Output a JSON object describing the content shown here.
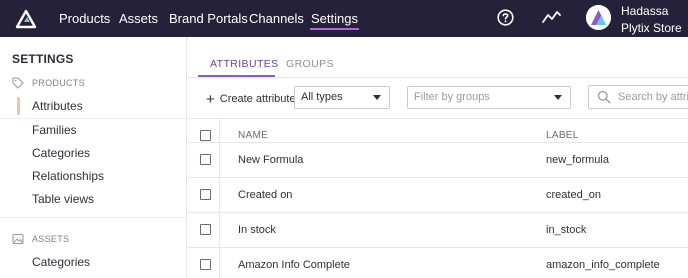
{
  "nav": {
    "items": [
      {
        "label": "Products"
      },
      {
        "label": "Assets"
      },
      {
        "label": "Brand Portals"
      },
      {
        "label": "Channels"
      },
      {
        "label": "Settings",
        "active": true
      }
    ],
    "help_icon": "question-circle-icon",
    "activity_icon": "activity-chart-icon",
    "accent_color": "#a86ad8"
  },
  "user": {
    "first_line": "Hadassa",
    "second_line": "Plytix Store"
  },
  "sidebar": {
    "title": "SETTINGS",
    "products_section": {
      "label": "PRODUCTS",
      "icon": "tag-icon",
      "items": [
        {
          "label": "Attributes",
          "active": true
        },
        {
          "label": "Families"
        },
        {
          "label": "Categories"
        },
        {
          "label": "Relationships"
        },
        {
          "label": "Table views"
        }
      ]
    },
    "assets_section": {
      "label": "ASSETS",
      "icon": "image-icon",
      "items": [
        {
          "label": "Categories"
        }
      ]
    }
  },
  "tabs": [
    {
      "label": "ATTRIBUTES",
      "active": true
    },
    {
      "label": "GROUPS"
    }
  ],
  "toolbar": {
    "create_label": "Create attribute",
    "type_select_value": "All types",
    "group_select_placeholder": "Filter by groups",
    "search_placeholder": "Search by attri"
  },
  "table": {
    "columns": [
      "NAME",
      "LABEL"
    ],
    "rows": [
      {
        "name": "New Formula",
        "label": "new_formula"
      },
      {
        "name": "Created on",
        "label": "created_on"
      },
      {
        "name": "In stock",
        "label": "in_stock"
      },
      {
        "name": "Amazon Info Complete",
        "label": "amazon_info_complete"
      }
    ]
  }
}
